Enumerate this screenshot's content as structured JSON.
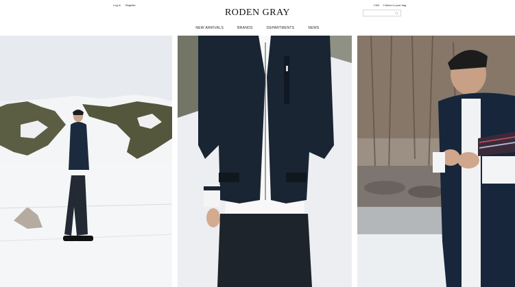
{
  "account": {
    "login": "Log in",
    "register": "Register"
  },
  "brand": {
    "logo": "RODEN GRAY"
  },
  "utility": {
    "currency": "CAD",
    "bag": "0 items in your bag"
  },
  "search": {
    "placeholder": ""
  },
  "nav": [
    {
      "label": "NEW ARRIVALS"
    },
    {
      "label": "BRANDS"
    },
    {
      "label": "DEPARTMENTS"
    },
    {
      "label": "NEWS"
    }
  ],
  "colors": {
    "background": "#ffffff",
    "text": "#222222",
    "navy": "#1c2a3e",
    "snow": "#f2f3f5"
  },
  "icons": {
    "search": "magnifier-icon"
  }
}
